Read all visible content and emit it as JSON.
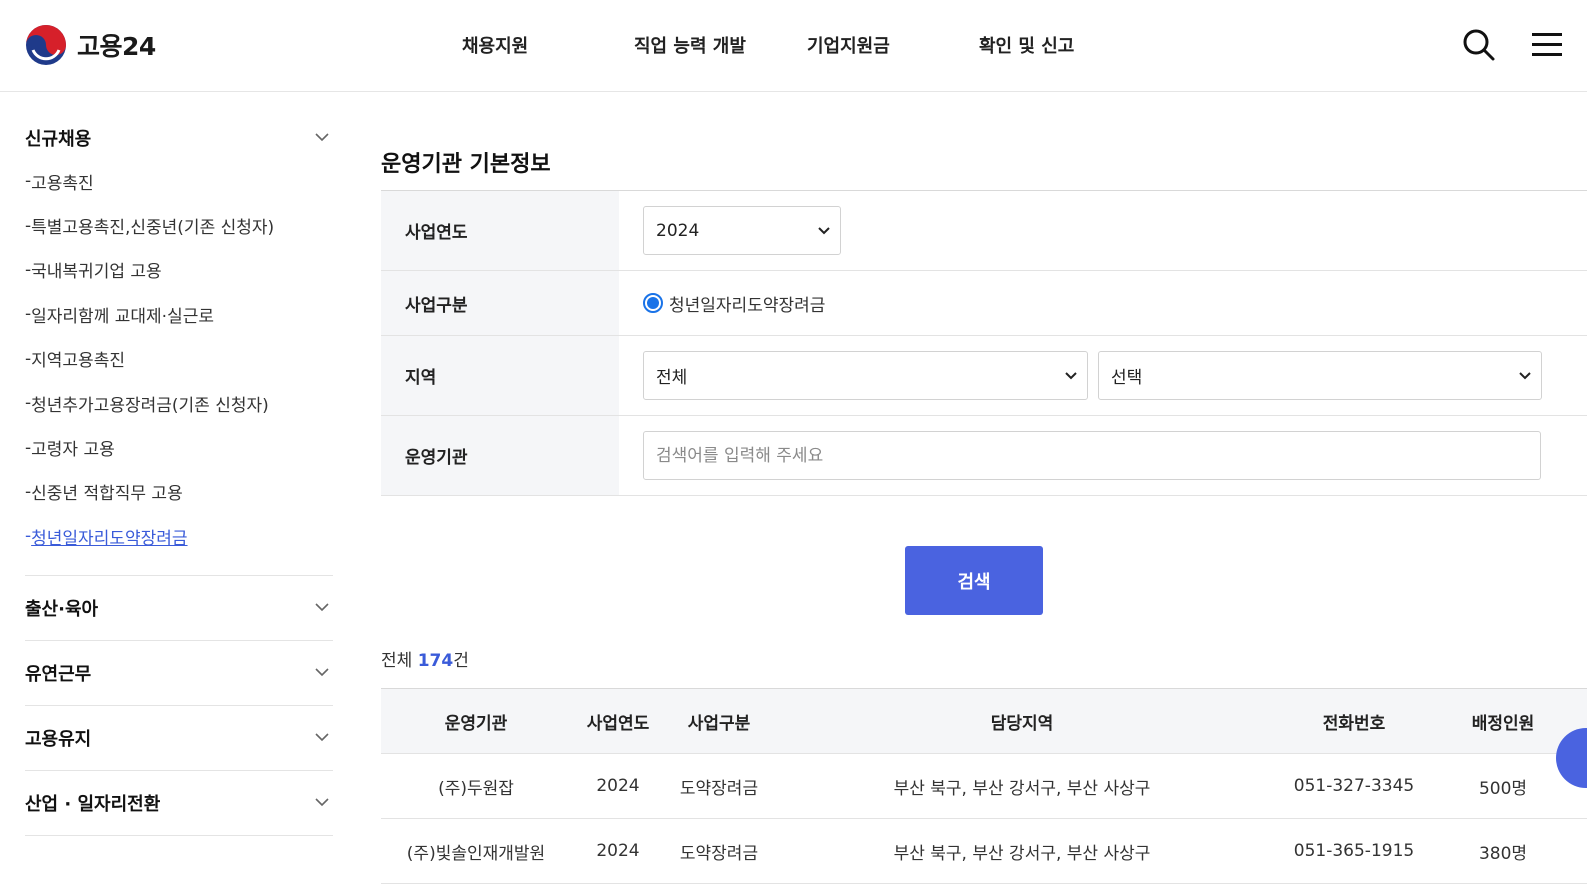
{
  "header": {
    "logo_text": "고용24",
    "nav": [
      {
        "label": "채용지원"
      },
      {
        "label": "직업 능력 개발"
      },
      {
        "label": "기업지원금"
      },
      {
        "label": "확인 및 신고"
      }
    ],
    "icons": {
      "search": "search-icon",
      "menu": "hamburger-menu-icon"
    }
  },
  "sidebar": {
    "groups": [
      {
        "title": "신규채용",
        "expanded": true,
        "items": [
          {
            "label": "고용촉진"
          },
          {
            "label": "특별고용촉진,신중년(기존 신청자)"
          },
          {
            "label": "국내복귀기업 고용"
          },
          {
            "label": "일자리함께 교대제·실근로"
          },
          {
            "label": "지역고용촉진"
          },
          {
            "label": "청년추가고용장려금(기존 신청자)"
          },
          {
            "label": "고령자 고용"
          },
          {
            "label": "신중년 적합직무 고용"
          },
          {
            "label": "청년일자리도약장려금",
            "active": true
          }
        ]
      },
      {
        "title": "출산·육아"
      },
      {
        "title": "유연근무"
      },
      {
        "title": "고용유지"
      },
      {
        "title": "산업 · 일자리전환"
      }
    ],
    "item_prefix": "- "
  },
  "main": {
    "section_title": "운영기관 기본정보",
    "form": {
      "year_label": "사업연도",
      "year_value": "2024",
      "type_label": "사업구분",
      "type_option": "청년일자리도약장려금",
      "region_label": "지역",
      "region_value": "전체",
      "subregion_value": "선택",
      "org_label": "운영기관",
      "org_placeholder": "검색어를 입력해 주세요"
    },
    "search_button": "검색",
    "total_prefix": "전체 ",
    "total_count": "174",
    "total_suffix": "건",
    "table": {
      "columns": [
        "운영기관",
        "사업연도",
        "사업구분",
        "담당지역",
        "전화번호",
        "배정인원"
      ],
      "rows": [
        [
          "(주)두원잡",
          "2024",
          "도약장려금",
          "부산 북구, 부산 강서구, 부산 사상구",
          "051-327-3345",
          "500명"
        ],
        [
          "(주)빛솔인재개발원",
          "2024",
          "도약장려금",
          "부산 북구, 부산 강서구, 부산 사상구",
          "051-365-1915",
          "380명"
        ]
      ]
    }
  },
  "colors": {
    "accent": "#4a63e0",
    "link": "#3a5bd9"
  }
}
